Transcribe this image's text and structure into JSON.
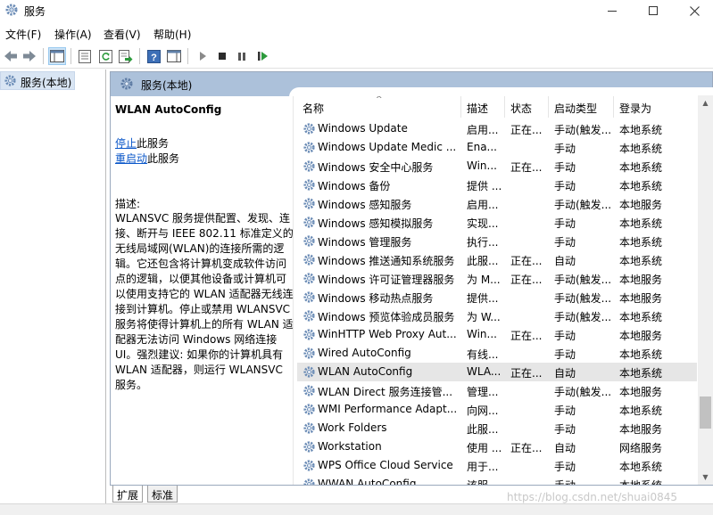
{
  "window": {
    "title": "服务",
    "controls": [
      "minimize",
      "maximize",
      "close"
    ]
  },
  "menu": [
    "文件(F)",
    "操作(A)",
    "查看(V)",
    "帮助(H)"
  ],
  "toolbar": [
    "back-icon",
    "forward-icon",
    "show-tree-icon",
    "properties-icon",
    "refresh-icon",
    "export-icon",
    "help-icon",
    "action-pane-icon",
    "start-icon",
    "stop-icon",
    "pause-icon",
    "restart-icon"
  ],
  "tree": {
    "item": "服务(本地)"
  },
  "panel": {
    "header": "服务(本地)"
  },
  "detail": {
    "service_name": "WLAN AutoConfig",
    "stop_link": "停止",
    "stop_suffix": "此服务",
    "restart_link": "重启动",
    "restart_suffix": "此服务",
    "desc_label": "描述:",
    "desc_lines": [
      "WLANSVC 服务提供配置、发现、连",
      "接、断开与 IEEE 802.11 标准定义的",
      "无线局域网(WLAN)的连接所需的逻",
      "辑。它还包含将计算机变成软件访问",
      "点的逻辑，以便其他设备或计算机可",
      "以使用支持它的 WLAN 适配器无线连",
      "接到计算机。停止或禁用 WLANSVC",
      "服务将使得计算机上的所有 WLAN 适",
      "配器无法访问 Windows 网络连接",
      "UI。强烈建议: 如果你的计算机具有",
      "WLAN 适配器，则运行 WLANSVC",
      "服务。"
    ]
  },
  "columns": [
    "名称",
    "描述",
    "状态",
    "启动类型",
    "登录为"
  ],
  "services": [
    {
      "name": "Windows Update",
      "desc": "启用...",
      "status": "正在...",
      "startup": "手动(触发...",
      "logon": "本地系统"
    },
    {
      "name": "Windows Update Medic ...",
      "desc": "Ena...",
      "status": "",
      "startup": "手动",
      "logon": "本地系统"
    },
    {
      "name": "Windows 安全中心服务",
      "desc": "Win...",
      "status": "正在...",
      "startup": "手动",
      "logon": "本地系统"
    },
    {
      "name": "Windows 备份",
      "desc": "提供 ...",
      "status": "",
      "startup": "手动",
      "logon": "本地系统"
    },
    {
      "name": "Windows 感知服务",
      "desc": "启用...",
      "status": "",
      "startup": "手动(触发...",
      "logon": "本地服务"
    },
    {
      "name": "Windows 感知模拟服务",
      "desc": "实现...",
      "status": "",
      "startup": "手动",
      "logon": "本地系统"
    },
    {
      "name": "Windows 管理服务",
      "desc": "执行...",
      "status": "",
      "startup": "手动",
      "logon": "本地系统"
    },
    {
      "name": "Windows 推送通知系统服务",
      "desc": "此服...",
      "status": "正在...",
      "startup": "自动",
      "logon": "本地系统"
    },
    {
      "name": "Windows 许可证管理器服务",
      "desc": "为 M...",
      "status": "正在...",
      "startup": "手动(触发...",
      "logon": "本地服务"
    },
    {
      "name": "Windows 移动热点服务",
      "desc": "提供...",
      "status": "",
      "startup": "手动(触发...",
      "logon": "本地服务"
    },
    {
      "name": "Windows 预览体验成员服务",
      "desc": "为 W...",
      "status": "",
      "startup": "手动(触发...",
      "logon": "本地系统"
    },
    {
      "name": "WinHTTP Web Proxy Aut...",
      "desc": "Win...",
      "status": "正在...",
      "startup": "手动",
      "logon": "本地服务"
    },
    {
      "name": "Wired AutoConfig",
      "desc": "有线...",
      "status": "",
      "startup": "手动",
      "logon": "本地系统"
    },
    {
      "name": "WLAN AutoConfig",
      "desc": "WLA...",
      "status": "正在...",
      "startup": "自动",
      "logon": "本地系统",
      "selected": true
    },
    {
      "name": "WLAN Direct 服务连接管...",
      "desc": "管理...",
      "status": "",
      "startup": "手动(触发...",
      "logon": "本地服务"
    },
    {
      "name": "WMI Performance Adapt...",
      "desc": "向网...",
      "status": "",
      "startup": "手动",
      "logon": "本地系统"
    },
    {
      "name": "Work Folders",
      "desc": "此服...",
      "status": "",
      "startup": "手动",
      "logon": "本地服务"
    },
    {
      "name": "Workstation",
      "desc": "使用 ...",
      "status": "正在...",
      "startup": "自动",
      "logon": "网络服务"
    },
    {
      "name": "WPS Office Cloud Service",
      "desc": "用于...",
      "status": "",
      "startup": "手动",
      "logon": "本地系统"
    },
    {
      "name": "WWAN AutoConfig",
      "desc": "该服...",
      "status": "",
      "startup": "手动",
      "logon": "本地系统"
    }
  ],
  "tabs": [
    "扩展",
    "标准"
  ],
  "watermark": "https://blog.csdn.net/shuai0845"
}
